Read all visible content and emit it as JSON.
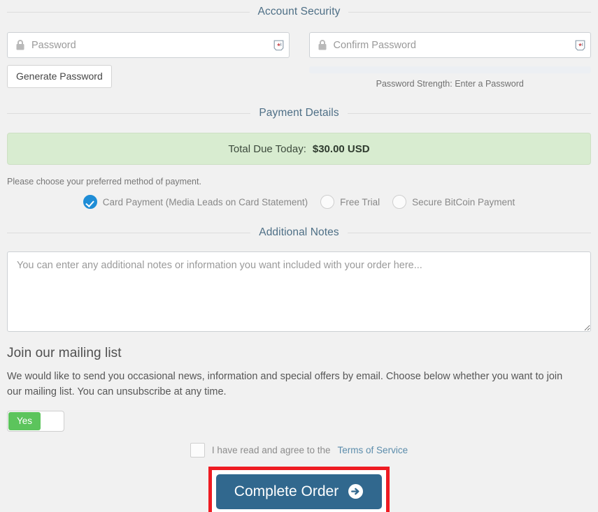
{
  "sections": {
    "account_security": {
      "legend": "Account Security",
      "password": {
        "placeholder": "Password",
        "value": "",
        "lock_icon": "lock-icon",
        "manager_icon": "password-manager-icon"
      },
      "confirm_password": {
        "placeholder": "Confirm Password",
        "value": "",
        "lock_icon": "lock-icon",
        "manager_icon": "password-manager-icon"
      },
      "generate_button": "Generate Password",
      "strength": {
        "label": "Password Strength: Enter a Password",
        "percent": 0
      }
    },
    "payment_details": {
      "legend": "Payment Details",
      "total_label": "Total Due Today:",
      "total_amount": "$30.00 USD",
      "note": "Please choose your preferred method of payment.",
      "methods": [
        {
          "label": "Card Payment (Media Leads on Card Statement)",
          "selected": true
        },
        {
          "label": "Free Trial",
          "selected": false
        },
        {
          "label": "Secure BitCoin Payment",
          "selected": false
        }
      ]
    },
    "additional_notes": {
      "legend": "Additional Notes",
      "placeholder": "You can enter any additional notes or information you want included with your order here...",
      "value": ""
    },
    "mailing_list": {
      "title": "Join our mailing list",
      "description": "We would like to send you occasional news, information and special offers by email. Choose below whether you want to join our mailing list. You can unsubscribe at any time.",
      "toggle_value": "Yes"
    },
    "terms": {
      "text_before_link": "I have read and agree to the",
      "link_label": "Terms of Service",
      "checked": false
    },
    "submit": {
      "label": "Complete Order",
      "arrow_icon": "arrow-right-circle-icon",
      "highlighted": true
    }
  },
  "colors": {
    "page_bg": "#f1f1f1",
    "legend_text": "#4e6f86",
    "button_primary": "#31688e",
    "highlight_border": "#ee1b22",
    "total_box_bg": "#d8ecd0",
    "radio_selected": "#1f8dd6",
    "toggle_on": "#5cc45c",
    "link": "#5b8cab"
  }
}
